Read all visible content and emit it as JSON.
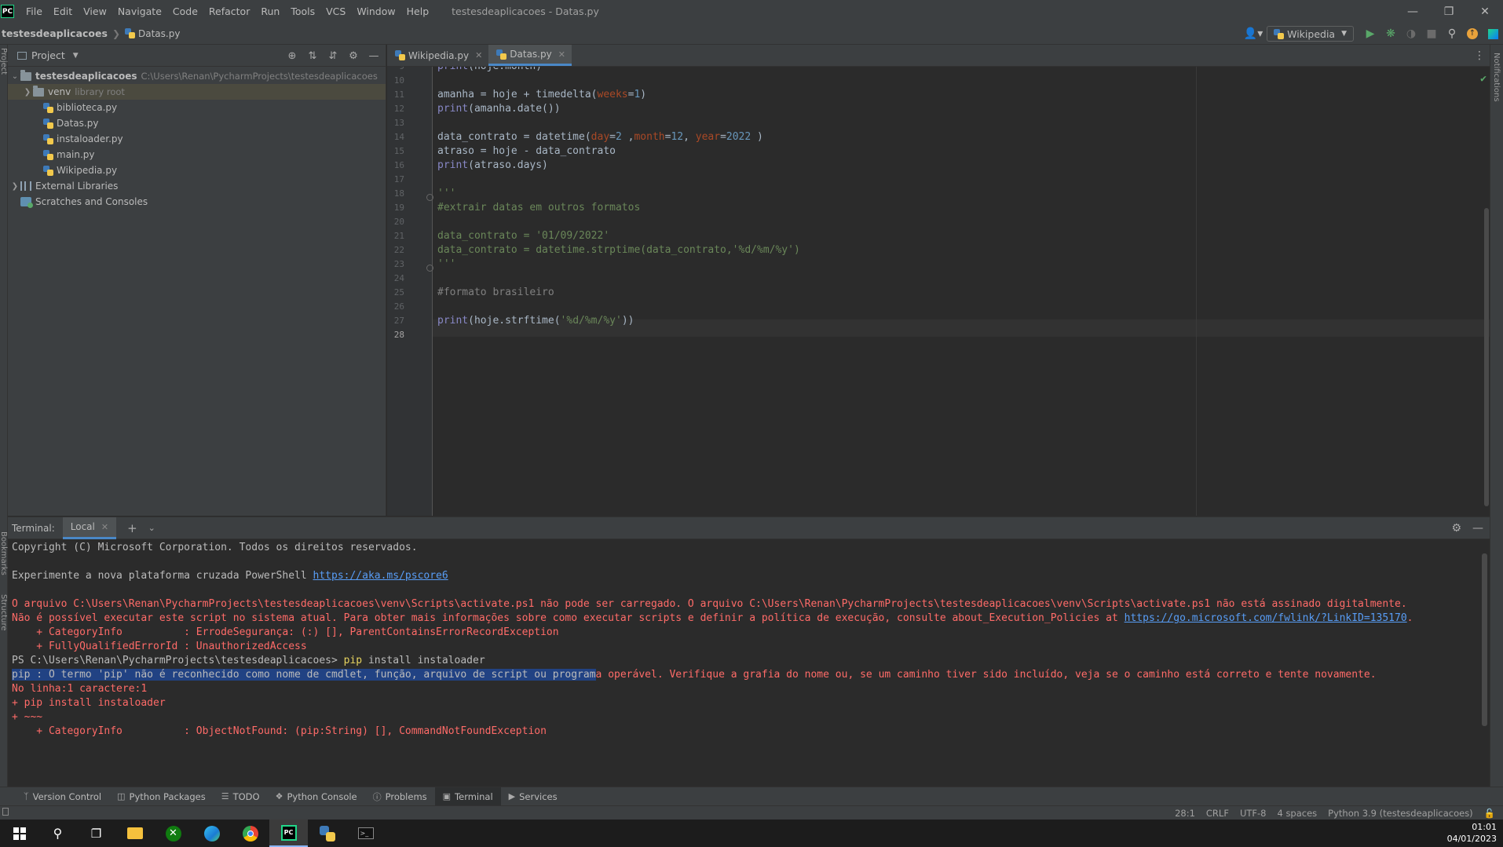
{
  "app": {
    "logo": "PC",
    "menu": [
      "File",
      "Edit",
      "View",
      "Navigate",
      "Code",
      "Refactor",
      "Run",
      "Tools",
      "VCS",
      "Window",
      "Help"
    ],
    "window_title": "testesdeaplicacoes - Datas.py"
  },
  "breadcrumb": {
    "project": "testesdeaplicacoes",
    "file": "Datas.py"
  },
  "toolbar": {
    "run_config": "Wikipedia"
  },
  "left_stripe": {
    "project_label": "Project",
    "bookmarks_label": "Bookmarks",
    "structure_label": "Structure"
  },
  "right_stripe": {
    "notifications_label": "Notifications"
  },
  "project_panel": {
    "title": "Project",
    "root": {
      "name": "testesdeaplicacoes",
      "path": "C:\\Users\\Renan\\PycharmProjects\\testesdeaplicacoes"
    },
    "venv": {
      "name": "venv",
      "hint": "library root"
    },
    "files": [
      "biblioteca.py",
      "Datas.py",
      "instaloader.py",
      "main.py",
      "Wikipedia.py"
    ],
    "external_libraries": "External Libraries",
    "scratches": "Scratches and Consoles"
  },
  "editor": {
    "tabs": [
      {
        "label": "Wikipedia.py",
        "active": false
      },
      {
        "label": "Datas.py",
        "active": true
      }
    ],
    "current_line": 28
  },
  "terminal": {
    "label": "Terminal:",
    "tab": "Local",
    "lines": {
      "copyright": "Copyright (C) Microsoft Corporation. Todos os direitos reservados.",
      "experimente": "Experimente a nova plataforma cruzada PowerShell ",
      "experimente_link": "https://aka.ms/pscore6",
      "err1": "O arquivo C:\\Users\\Renan\\PycharmProjects\\testesdeaplicacoes\\venv\\Scripts\\activate.ps1 não pode ser carregado. O arquivo C:\\Users\\Renan\\PycharmProjects\\testesdeaplicacoes\\venv\\Scripts\\activate.ps1 não está assinado digitalmente.",
      "err2": "Não é possível executar este script no sistema atual. Para obter mais informações sobre como executar scripts e definir a política de execução, consulte about_Execution_Policies at ",
      "err2_link": "https://go.microsoft.com/fwlink/?LinkID=135170",
      "err2_end": ".",
      "err3": "    + CategoryInfo          : ErrodeSegurança: (:) [], ParentContainsErrorRecordException",
      "err4": "    + FullyQualifiedErrorId : UnauthorizedAccess",
      "prompt": "PS C:\\Users\\Renan\\PycharmProjects\\testesdeaplicacoes> ",
      "prompt_cmd": "pip",
      "prompt_args": " install instaloader",
      "err5_selected": "pip : O termo 'pip' não é reconhecido como nome de cmdlet, função, arquivo de script ou program",
      "err5_rest": "a operável. Verifique a grafia do nome ou, se um caminho tiver sido incluído, veja se o caminho está correto e tente novamente.",
      "err6": "No linha:1 caractere:1",
      "err7": "+ pip install instaloader",
      "err8": "+ ~~~",
      "err9": "    + CategoryInfo          : ObjectNotFound: (pip:String) [], CommandNotFoundException"
    }
  },
  "tool_windows": [
    {
      "label": "Version Control",
      "icon": "branch-icon",
      "active": false
    },
    {
      "label": "Python Packages",
      "icon": "packages-icon",
      "active": false
    },
    {
      "label": "TODO",
      "icon": "list-icon",
      "active": false
    },
    {
      "label": "Python Console",
      "icon": "python-icon",
      "active": false
    },
    {
      "label": "Problems",
      "icon": "info-icon",
      "active": false
    },
    {
      "label": "Terminal",
      "icon": "terminal-icon",
      "active": true
    },
    {
      "label": "Services",
      "icon": "services-icon",
      "active": false
    }
  ],
  "statusbar": {
    "position": "28:1",
    "line_sep": "CRLF",
    "encoding": "UTF-8",
    "indent": "4 spaces",
    "interpreter": "Python 3.9 (testesdeaplicacoes)"
  },
  "taskbar": {
    "time": "01:01",
    "date": "04/01/2023"
  },
  "colors": {
    "accent": "#4a88c7",
    "error": "#ff6b68",
    "link": "#589df6",
    "selection": "#214283"
  }
}
